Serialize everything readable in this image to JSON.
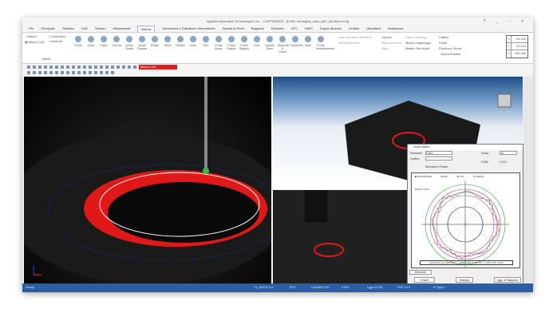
{
  "window": {
    "title": "Applied Automation Technologies, Inc. - CAPPSNMG3 - [Collin: immagina_case_spl0_(struttura.rnd)]",
    "controls": "? _ ▫ ×"
  },
  "menu_tabs": [
    "File",
    "Principale",
    "Sistema",
    "CAD",
    "Sensori",
    "Allineamenti",
    "Misura",
    "Dimensioni e Tolleranze Geometriche",
    "Nuvola di Punti",
    "Rapporto",
    "Etichetta",
    "UFC",
    "DMIS",
    "Doppio Braccio",
    "Grafica",
    "Visualizza",
    "Assistenza"
  ],
  "active_tab": "Misura",
  "ribbon": {
    "radios": [
      {
        "label": "Misura",
        "checked": false
      },
      {
        "label": "Misura CAD",
        "checked": true
      },
      {
        "label": "Costruzioni",
        "checked": false
      },
      {
        "label": "Nominali",
        "checked": false
      }
    ],
    "group_label": "Misuri",
    "tools": [
      "Punto",
      "Linea",
      "Piano",
      "Cerchio",
      "Asola Tonda",
      "Asola Quadra",
      "Ellisse",
      "Sfera",
      "Cilindro",
      "Cono",
      "Toro",
      "Punto Bordo",
      "Punto Angolo",
      "Punto Spigolo",
      "Arco",
      "Opzioni Serie",
      "Superfici & Curve",
      "Superficie",
      "Serie",
      "Punto Avvicinamento"
    ],
    "links": [
      "Auto Selezione Elementi",
      "Estrai Elementi",
      "Opzioni",
      "Piano di lavoro",
      "Tasto",
      "Laser Scanning",
      "Modulo Ingranaggi",
      "Master Part Mode",
      "Calibra",
      "Ruota",
      "Posiziona Tavola",
      "Tavola Rotante"
    ],
    "coords": [
      {
        "axis": "X",
        "value": "84.433"
      },
      {
        "axis": "Y",
        "value": "-35.163"
      },
      {
        "axis": "Z",
        "value": "-289.436"
      }
    ]
  },
  "toolbar": {
    "mode_select": "Misura CAD"
  },
  "dialog": {
    "title": "Vista Grafico",
    "fields": [
      {
        "label": "Elemento",
        "value": "CIR1"
      },
      {
        "label": "Grafico",
        "value": ""
      },
      {
        "label": "Scala",
        "value": "10"
      }
    ],
    "options": [
      "Sfumatura Polare"
    ],
    "values": [
      "0.000",
      "0.010"
    ],
    "legend": [
      "DEVIAZIONE",
      "MIN",
      "TOL",
      "LIMITE",
      "MAX TOLS"
    ],
    "summary": "Deviazione per CERCHIO — 0.009  0.028 -0.030  TOL: -0.100  +TOL: 0.100",
    "tab": "Elementi",
    "button_left": "Chiudi",
    "button_mid": "Stampa",
    "button_right": "Agg. a Rapporto"
  },
  "status": {
    "left": "Ready",
    "items": [
      "T1_ARITS 0.4",
      "RTA",
      "Coll ABS ISO",
      "0.000",
      "Lgge 10.00",
      "RTE 10.0",
      "R Type 1"
    ]
  },
  "colors": {
    "accent": "#2a5fa8",
    "highlight": "#e02020"
  }
}
